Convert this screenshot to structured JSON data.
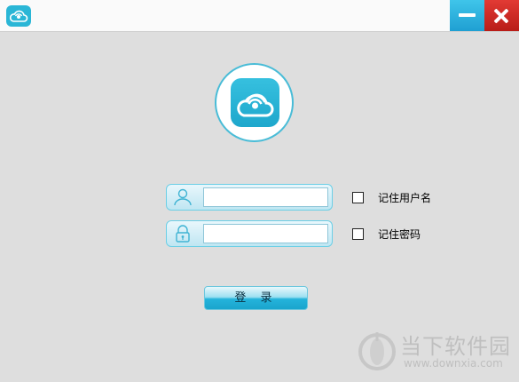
{
  "login": {
    "remember_username_label": "记住用户名",
    "remember_password_label": "记住密码",
    "login_button_label": "登 录"
  },
  "watermark": {
    "title": "当下软件园",
    "url": "www.downxia.com"
  },
  "icons": {
    "app": "cloud-eye-icon",
    "user": "user-icon",
    "lock": "lock-icon",
    "minimize": "minimize-icon",
    "close": "close-icon"
  },
  "colors": {
    "accent": "#2ab6d6",
    "close": "#d32a25",
    "background": "#dedede"
  }
}
